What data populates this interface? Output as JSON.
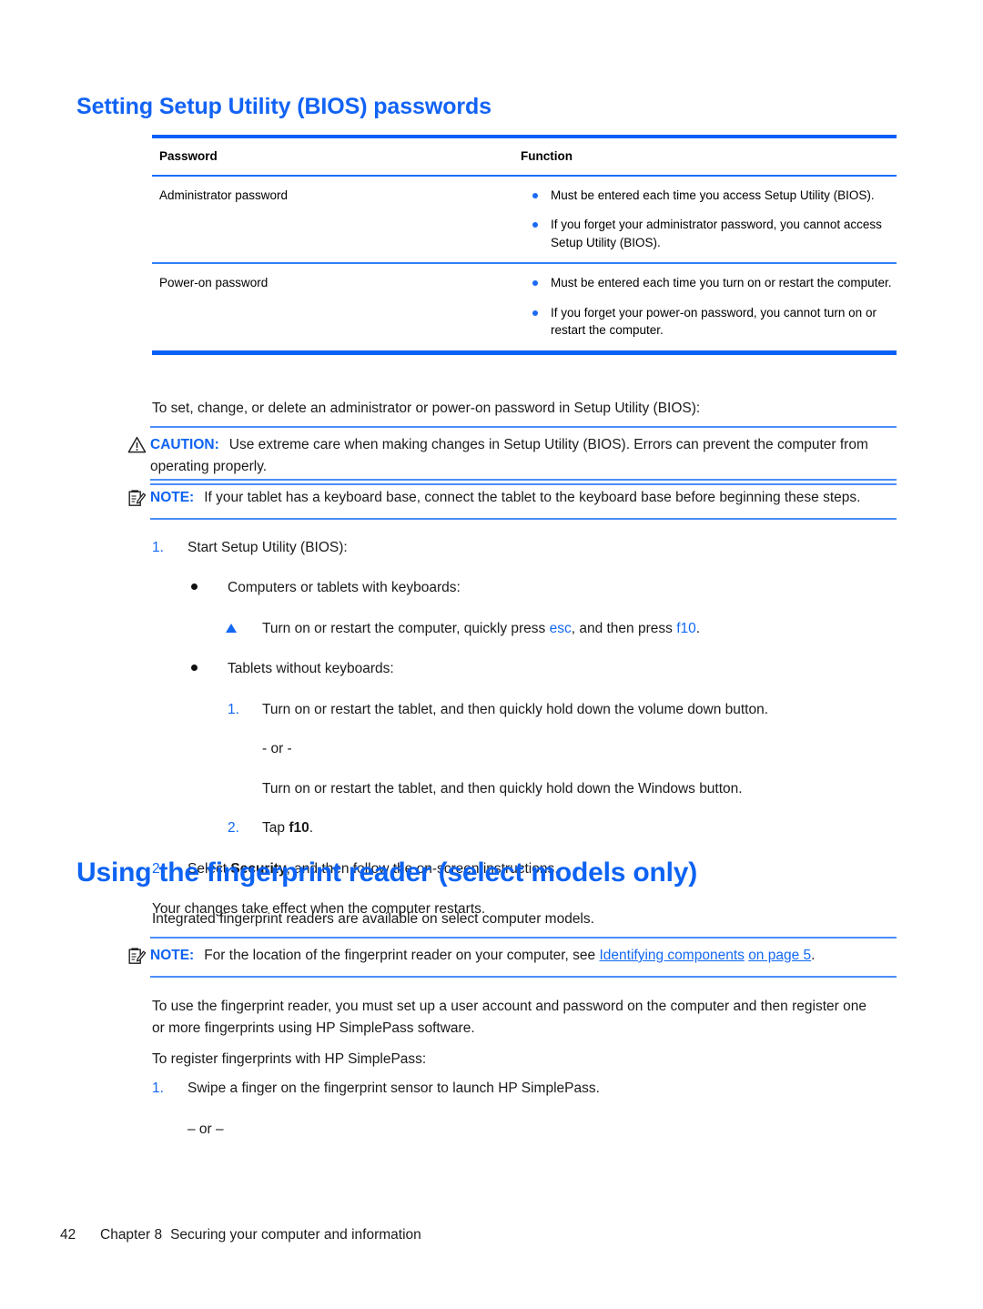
{
  "document": {
    "section_heading": "Setting Setup Utility (BIOS) passwords",
    "chapter_heading": "Using the fingerprint reader (select models only)"
  },
  "password_table": {
    "columns": [
      "Password",
      "Function"
    ],
    "rows": [
      {
        "password": "Administrator password",
        "functions": [
          "Must be entered each time you access Setup Utility (BIOS).",
          "If you forget your administrator password, you cannot access Setup Utility (BIOS)."
        ]
      },
      {
        "password": "Power-on password",
        "functions": [
          "Must be entered each time you turn on or restart the computer.",
          "If you forget your power-on password, you cannot turn on or restart the computer."
        ]
      }
    ]
  },
  "intro": {
    "set_change_delete": "To set, change, or delete an administrator or power-on password in Setup Utility (BIOS):"
  },
  "caution": {
    "label": "CAUTION:",
    "text": "Use extreme care when making changes in Setup Utility (BIOS). Errors can prevent the computer from operating properly."
  },
  "note_keyboard_base": {
    "label": "NOTE:",
    "text": "If your tablet has a keyboard base, connect the tablet to the keyboard base before beginning these steps."
  },
  "bios_steps": {
    "step1_num": "1.",
    "step1_text": "Start Setup Utility (BIOS):",
    "bullet_keyboards": "Computers or tablets with keyboards:",
    "keyboard_action_pre": "Turn on or restart the computer, quickly press ",
    "keyboard_action_key1": "esc",
    "keyboard_action_mid": ", and then press ",
    "keyboard_action_key2": "f10",
    "keyboard_action_post": ".",
    "bullet_no_keyboards": "Tablets without keyboards:",
    "sub1_num": "1.",
    "sub1_text": "Turn on or restart the tablet, and then quickly hold down the volume down button.",
    "or_separator": "- or -",
    "sub1_alt_text": "Turn on or restart the tablet, and then quickly hold down the Windows button.",
    "sub2_num": "2.",
    "sub2_text_pre": "Tap ",
    "sub2_key": "f10",
    "sub2_text_post": ".",
    "step2_num": "2.",
    "step2_pre": "Select ",
    "step2_bold": "Security",
    "step2_post": ", and then follow the on-screen instructions.",
    "closing": "Your changes take effect when the computer restarts."
  },
  "fingerprint": {
    "intro": "Integrated fingerprint readers are available on select computer models.",
    "note_label": "NOTE:",
    "note_pre": "For the location of the fingerprint reader on your computer, see ",
    "note_link_line1": "Identifying components",
    "note_link_line2": "on page 5",
    "note_post": ".",
    "setup_text": "To use the fingerprint reader, you must set up a user account and password on the computer and then register one or more fingerprints using HP SimplePass software.",
    "register_text": "To register fingerprints with HP SimplePass:",
    "step1_num": "1.",
    "step1_text": "Swipe a finger on the fingerprint sensor to launch HP SimplePass.",
    "or_separator": "– or –"
  },
  "footer": {
    "page_number": "42",
    "chapter": "Chapter 8",
    "title": "Securing your computer and information"
  },
  "icons": {
    "caution": "warning-triangle-icon",
    "note": "note-clipboard-icon",
    "table_bullet": "blue-dot-bullet-icon",
    "list_bullet": "black-dot-bullet-icon",
    "action_bullet": "blue-triangle-bullet-icon"
  },
  "colors": {
    "heading_blue": "#0d63f3",
    "rule_blue": "#0a5ff5",
    "link_blue": "#1268f4",
    "text_black": "#1b1b1b"
  }
}
